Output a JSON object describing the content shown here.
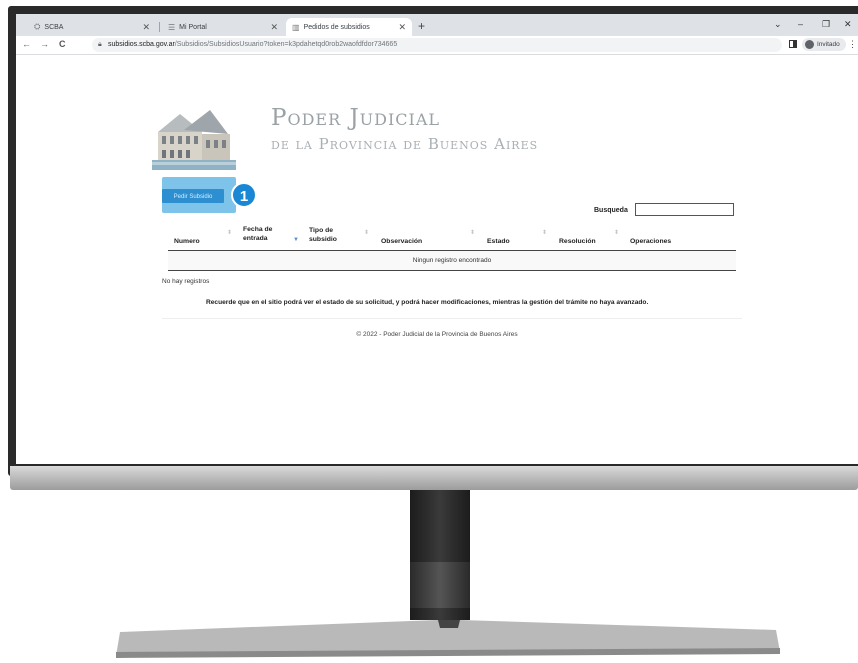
{
  "browser": {
    "tabs": [
      {
        "label": "SCBA"
      },
      {
        "label": "Mi Portal"
      },
      {
        "label": "Pedidos de subsidios"
      }
    ],
    "url_host": "subsidios.scba.gov.ar",
    "url_path": "/Subsidios/SubsidiosUsuario?token=k3pdahetqd0rob2waofdfdor734665",
    "profile_label": "Invitado"
  },
  "header": {
    "title_main": "Poder Judicial",
    "title_sub": "de la Provincia de Buenos Aires"
  },
  "actions": {
    "pedir_subsidio": "Pedir Subsidio",
    "step_number": "1"
  },
  "search": {
    "label": "Busqueda",
    "value": ""
  },
  "table": {
    "columns": [
      {
        "line1": "Numero",
        "line2": ""
      },
      {
        "line1": "Fecha de",
        "line2": "entrada"
      },
      {
        "line1": "Tipo de",
        "line2": "subsidio"
      },
      {
        "line1": "Observación",
        "line2": ""
      },
      {
        "line1": "Estado",
        "line2": ""
      },
      {
        "line1": "Resolución",
        "line2": ""
      },
      {
        "line1": "Operaciones",
        "line2": ""
      }
    ],
    "empty_message": "Ningun registro encontrado"
  },
  "status": {
    "no_records": "No hay registros",
    "notice": "Recuerde que en el sitio podrá ver el estado de su solicitud, y podrá hacer modificaciones, mientras la gestión del trámite no haya avanzado."
  },
  "footer": {
    "text": "© 2022 - Poder Judicial de la Provincia de Buenos Aires"
  },
  "colors": {
    "button_blue": "#2d8fd0",
    "highlight_blue": "#7dc3ea",
    "badge_blue": "#1a87d4",
    "title_gray": "#9aa2a6"
  }
}
